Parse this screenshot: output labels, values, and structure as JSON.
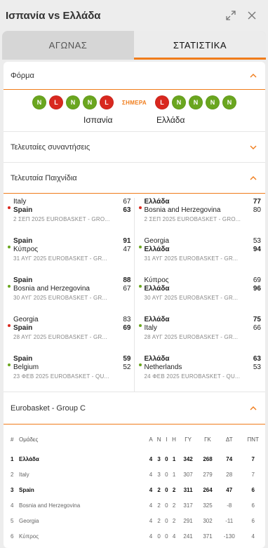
{
  "header": {
    "title": "Ισπανία vs Ελλάδα",
    "expand_icon": "expand-icon",
    "close_icon": "close-icon"
  },
  "tabs": [
    {
      "label": "ΑΓΩΝΑΣ"
    },
    {
      "label": "ΣΤΑΤΙΣΤΙΚΑ"
    }
  ],
  "active_tab": 1,
  "form": {
    "label": "Φόρμα",
    "today": "ΣΗΜΕΡΑ",
    "home_results": [
      "N",
      "L",
      "N",
      "N",
      "L"
    ],
    "away_results": [
      "L",
      "N",
      "N",
      "N",
      "N"
    ],
    "home_team": "Ισπανία",
    "away_team": "Ελλάδα"
  },
  "h2h": {
    "label": "Τελευταίες συναντήσεις"
  },
  "last_games": {
    "label": "Τελευταία Παιχνίδια",
    "home": [
      {
        "t1": "Italy",
        "s1": "67",
        "t2": "Spain",
        "s2": "63",
        "meta": "2 ΣΕΠ 2025 EUROBASKET - GRO...",
        "result": "loss",
        "bold": 2
      },
      {
        "t1": "Spain",
        "s1": "91",
        "t2": "Κύπρος",
        "s2": "47",
        "meta": "31 ΑΥΓ 2025 EUROBASKET - GR...",
        "result": "win",
        "bold": 1
      },
      {
        "t1": "Spain",
        "s1": "88",
        "t2": "Bosnia and Herzegovina",
        "s2": "67",
        "meta": "30 ΑΥΓ 2025 EUROBASKET - GR...",
        "result": "win",
        "bold": 1
      },
      {
        "t1": "Georgia",
        "s1": "83",
        "t2": "Spain",
        "s2": "69",
        "meta": "28 ΑΥΓ 2025 EUROBASKET - GR...",
        "result": "loss",
        "bold": 2
      },
      {
        "t1": "Spain",
        "s1": "59",
        "t2": "Belgium",
        "s2": "52",
        "meta": "23 ΦΕΒ 2025 EUROBASKET - QU...",
        "result": "win",
        "bold": 1
      }
    ],
    "away": [
      {
        "t1": "Ελλάδα",
        "s1": "77",
        "t2": "Bosnia and Herzegovina",
        "s2": "80",
        "meta": "2 ΣΕΠ 2025 EUROBASKET - GRO...",
        "result": "loss",
        "bold": 1
      },
      {
        "t1": "Georgia",
        "s1": "53",
        "t2": "Ελλάδα",
        "s2": "94",
        "meta": "31 ΑΥΓ 2025 EUROBASKET - GR...",
        "result": "win",
        "bold": 2
      },
      {
        "t1": "Κύπρος",
        "s1": "69",
        "t2": "Ελλάδα",
        "s2": "96",
        "meta": "30 ΑΥΓ 2025 EUROBASKET - GR...",
        "result": "win",
        "bold": 2
      },
      {
        "t1": "Ελλάδα",
        "s1": "75",
        "t2": "Italy",
        "s2": "66",
        "meta": "28 ΑΥΓ 2025 EUROBASKET - GR...",
        "result": "win",
        "bold": 1
      },
      {
        "t1": "Ελλάδα",
        "s1": "63",
        "t2": "Netherlands",
        "s2": "53",
        "meta": "24 ΦΕΒ 2025 EUROBASKET - QU...",
        "result": "win",
        "bold": 1
      }
    ]
  },
  "standings": {
    "label": "Eurobasket - Group C",
    "columns": [
      "#",
      "Ομάδες",
      "Α",
      "Ν",
      "Ι",
      "Η",
      "ΓΥ",
      "ΓΚ",
      "ΔΤ",
      "ΠΝΤ"
    ],
    "rows": [
      [
        "1",
        "Ελλάδα",
        "4",
        "3",
        "0",
        "1",
        "342",
        "268",
        "74",
        "7"
      ],
      [
        "2",
        "Italy",
        "4",
        "3",
        "0",
        "1",
        "307",
        "279",
        "28",
        "7"
      ],
      [
        "3",
        "Spain",
        "4",
        "2",
        "0",
        "2",
        "311",
        "264",
        "47",
        "6"
      ],
      [
        "4",
        "Bosnia and Herzegovina",
        "4",
        "2",
        "0",
        "2",
        "317",
        "325",
        "-8",
        "6"
      ],
      [
        "5",
        "Georgia",
        "4",
        "2",
        "0",
        "2",
        "291",
        "302",
        "-11",
        "6"
      ],
      [
        "6",
        "Κύπρος",
        "4",
        "0",
        "0",
        "4",
        "241",
        "371",
        "-130",
        "4"
      ]
    ],
    "bold_rows": [
      0,
      2
    ]
  },
  "colors": {
    "accent": "#f07c1a",
    "win": "#6aa61f",
    "loss": "#d9281f"
  }
}
